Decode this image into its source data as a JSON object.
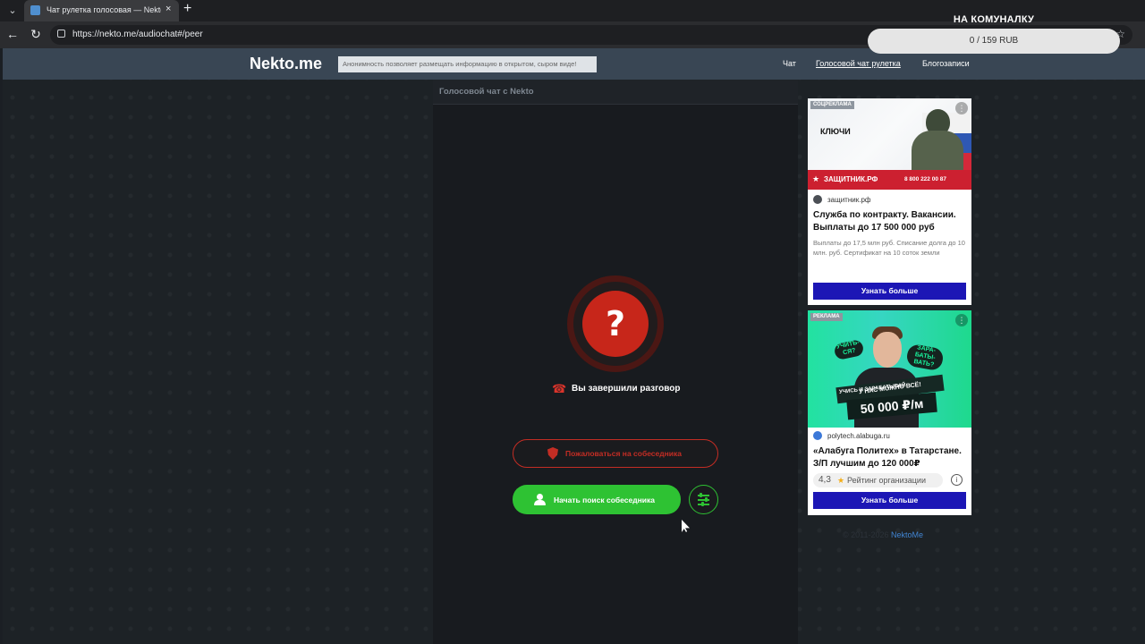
{
  "browser": {
    "tab_menu_icon": "chevron-down-icon",
    "tab_title": "Чат рулетка голосовая — Nekto.me",
    "tab_close": "×",
    "new_tab": "+",
    "back": "←",
    "reload": "↻",
    "url": "https://nekto.me/audiochat#/peer",
    "bookmark_star": "☆"
  },
  "donation_widget": {
    "title": "НА КОМУНАЛКУ",
    "progress_text": "0 / 159 RUB",
    "raised": 0,
    "goal": 159,
    "currency": "RUB"
  },
  "site": {
    "logo": "Nekto.me",
    "notice": "Анонимность позволяет размещать информацию в открытом, сыром виде!",
    "nav": [
      "Чат",
      "Голосовой чат рулетка",
      "Блогозаписи"
    ]
  },
  "chat": {
    "title": "Голосовой чат с Nekto",
    "status_symbol": "?",
    "ended_text": "Вы завершили разговор",
    "report_label": "Пожаловаться на собеседника",
    "search_label": "Начать поиск собеседника"
  },
  "ads": [
    {
      "label": "СОЦРЕКЛАМА",
      "image_text": "КЛЮЧИ",
      "strip_site": "ЗАЩИТНИК.РФ",
      "strip_phone": "8 800 222 00 87",
      "domain": "защитник.рф",
      "title": "Служба по контракту. Вакансии. Выплаты до 17 500 000 руб",
      "description": "Выплаты до 17,5 млн руб. Списание долга до 10 млн. руб. Сертификат на 10 соток земли",
      "button": "Узнать больше"
    },
    {
      "label": "РЕКЛАМА",
      "bubble_1": "УЧИТЬ-СЯ?",
      "bubble_2": "ЗАРА-БАТЫ-ВАТЬ?",
      "strip": "У НАС МОЖНО ВСЁ!",
      "sub": "УЧИСЬ И ЗАРАБАТЫВАЙ",
      "salary": "50 000 ₽/м",
      "domain": "polytech.alabuga.ru",
      "title": "«Алабуга Политех» в Татарстане. З/П лучшим до 120 000₽",
      "rating": "4,3",
      "rating_label": "Рейтинг организации",
      "button": "Узнать больше"
    }
  ],
  "footer": {
    "copyright": "© 2011-2026 ",
    "link": "NektoMe"
  }
}
